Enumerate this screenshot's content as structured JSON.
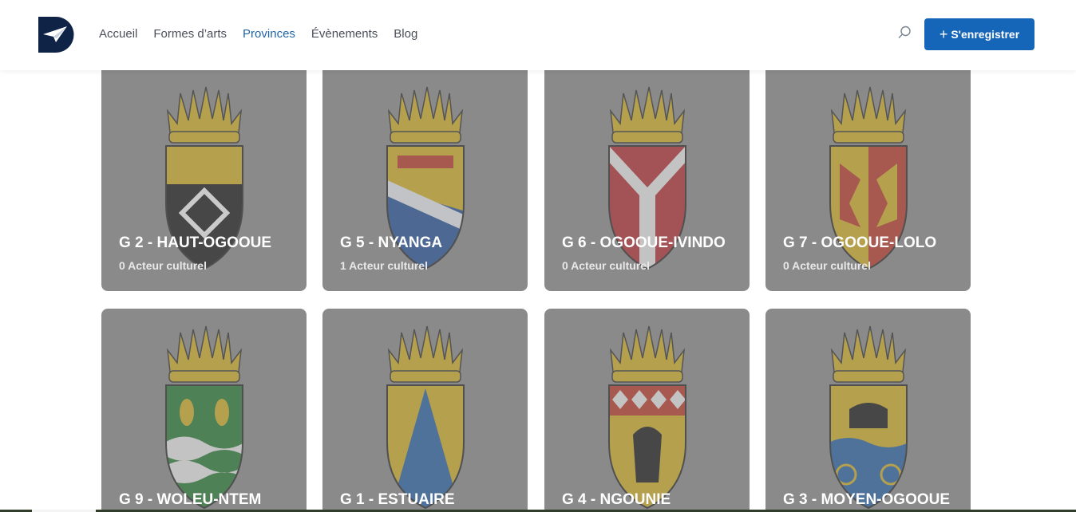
{
  "nav": {
    "items": [
      {
        "label": "Accueil",
        "active": false
      },
      {
        "label": "Formes d’arts",
        "active": false
      },
      {
        "label": "Provinces",
        "active": true
      },
      {
        "label": "Évènements",
        "active": false
      },
      {
        "label": "Blog",
        "active": false
      }
    ],
    "register_label": "S'enregistrer"
  },
  "colors": {
    "accent": "#1565b8",
    "active_nav": "#1f65a8",
    "card_overlay": "#8a8a8a"
  },
  "icons": {
    "logo": "paper-plane-logo-icon",
    "search": "search-icon",
    "plus": "plus-icon"
  },
  "provinces": [
    {
      "title": "G 2 - HAUT-OGOOUE",
      "count": "0 Acteur culturel",
      "crest": "haut-ogooue"
    },
    {
      "title": "G 5 - NYANGA",
      "count": "1 Acteur culturel",
      "crest": "nyanga"
    },
    {
      "title": "G 6 - OGOOUE-IVINDO",
      "count": "0 Acteur culturel",
      "crest": "ogooue-ivindo"
    },
    {
      "title": "G 7 - OGOOUE-LOLO",
      "count": "0 Acteur culturel",
      "crest": "ogooue-lolo"
    },
    {
      "title": "G 9 - WOLEU-NTEM",
      "count": "",
      "crest": "woleu-ntem"
    },
    {
      "title": "G 1 - ESTUAIRE",
      "count": "",
      "crest": "estuaire"
    },
    {
      "title": "G 4 - NGOUNIE",
      "count": "",
      "crest": "ngounie"
    },
    {
      "title": "G 3 - MOYEN-OGOOUE",
      "count": "",
      "crest": "moyen-ogooue"
    }
  ]
}
